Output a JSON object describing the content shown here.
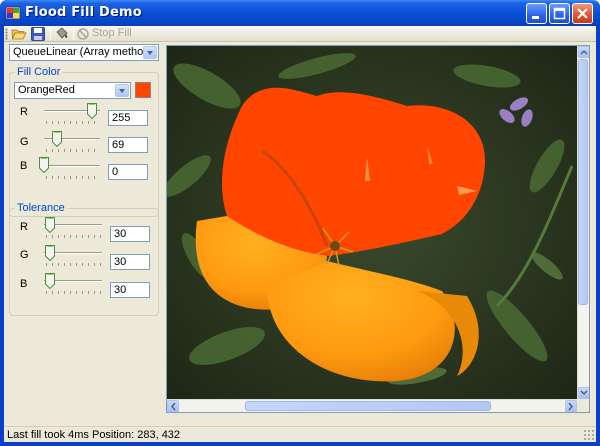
{
  "window": {
    "title": "Flood Fill Demo"
  },
  "toolbar": {
    "open_icon": "folder-open-icon",
    "save_icon": "save-disk-icon",
    "fill_icon": "paint-bucket-icon",
    "stop_label": "Stop Fill"
  },
  "fill_method": {
    "selected": "QueueLinear (Array method)"
  },
  "fill_color": {
    "title": "Fill Color",
    "color_name": "OrangeRed",
    "swatch": "#ff4500",
    "r_label": "R",
    "g_label": "G",
    "b_label": "B",
    "r_value": "255",
    "g_value": "69",
    "b_value": "0",
    "r_level": 1.0,
    "g_level": 0.27,
    "b_level": 0.0
  },
  "tolerance": {
    "title": "Tolerance",
    "r_label": "R",
    "g_label": "G",
    "b_label": "B",
    "r_value": "30",
    "g_value": "30",
    "b_value": "30",
    "r_level": 0.12,
    "g_level": 0.12,
    "b_level": 0.12
  },
  "status": {
    "text": "Last fill took 4ms  Position: 283, 432"
  },
  "colors": {
    "titlebar": "#0a4fd8",
    "accent_group_title": "#0046d5",
    "fill": "#ff4500"
  }
}
